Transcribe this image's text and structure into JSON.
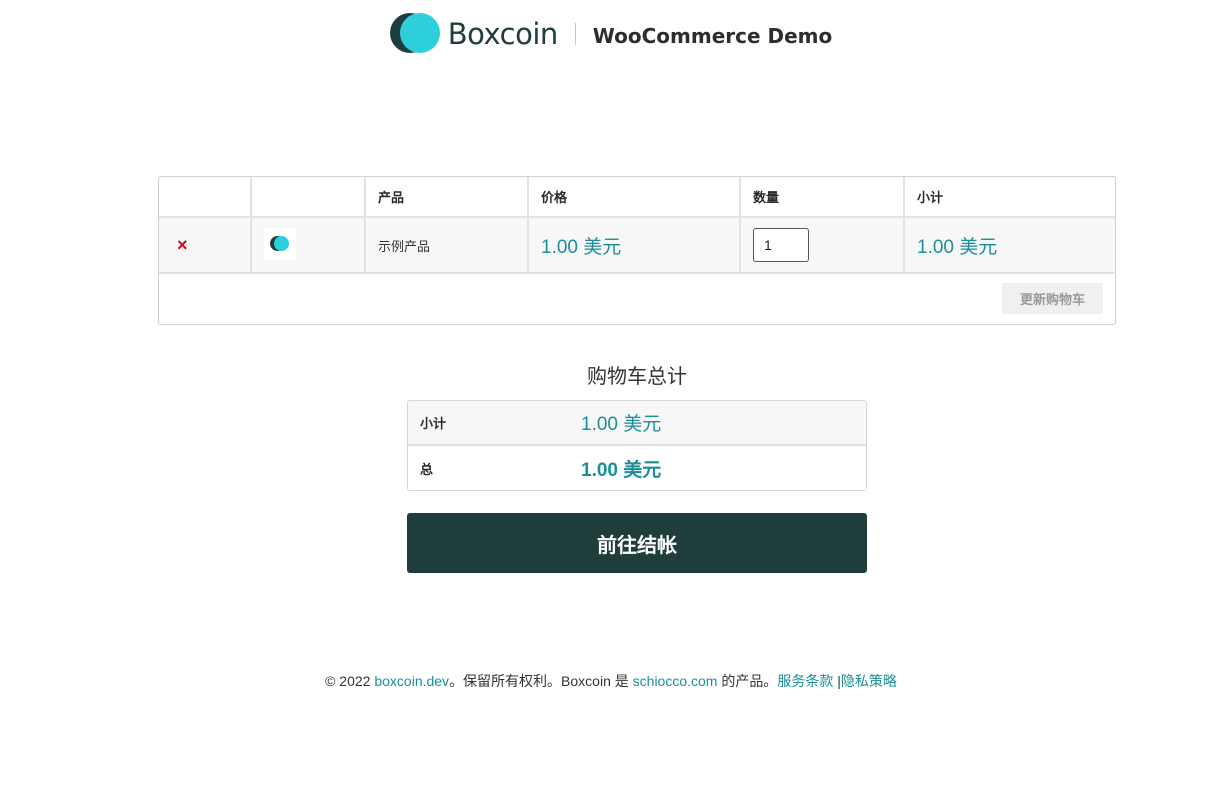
{
  "header": {
    "logo_text": "Boxcoin",
    "subtitle": "WooCommerce Demo"
  },
  "cart": {
    "columns": {
      "remove": "",
      "thumbnail": "",
      "product": "产品",
      "price": "价格",
      "quantity": "数量",
      "subtotal": "小计"
    },
    "items": [
      {
        "remove_label": "×",
        "product_name": "示例产品",
        "price": "1.00 美元",
        "quantity": "1",
        "subtotal": "1.00 美元"
      }
    ],
    "update_button": "更新购物车"
  },
  "totals": {
    "title": "购物车总计",
    "subtotal_label": "小计",
    "subtotal_value": "1.00 美元",
    "total_label": "总",
    "total_value": "1.00 美元"
  },
  "checkout_button": "前往结帐",
  "footer": {
    "copyright": "© 2022 ",
    "site_link": "boxcoin.dev",
    "rights_text": "。保留所有权利。Boxcoin 是 ",
    "company_link": "schiocco.com",
    "product_text": " 的产品。",
    "terms_link": "服务条款",
    "separator": " |",
    "privacy_link": "隐私策略"
  },
  "colors": {
    "brand_dark": "#1f3d3b",
    "brand_accent": "#2ecfdc",
    "link": "#1a8f99",
    "remove": "#e0001b"
  }
}
